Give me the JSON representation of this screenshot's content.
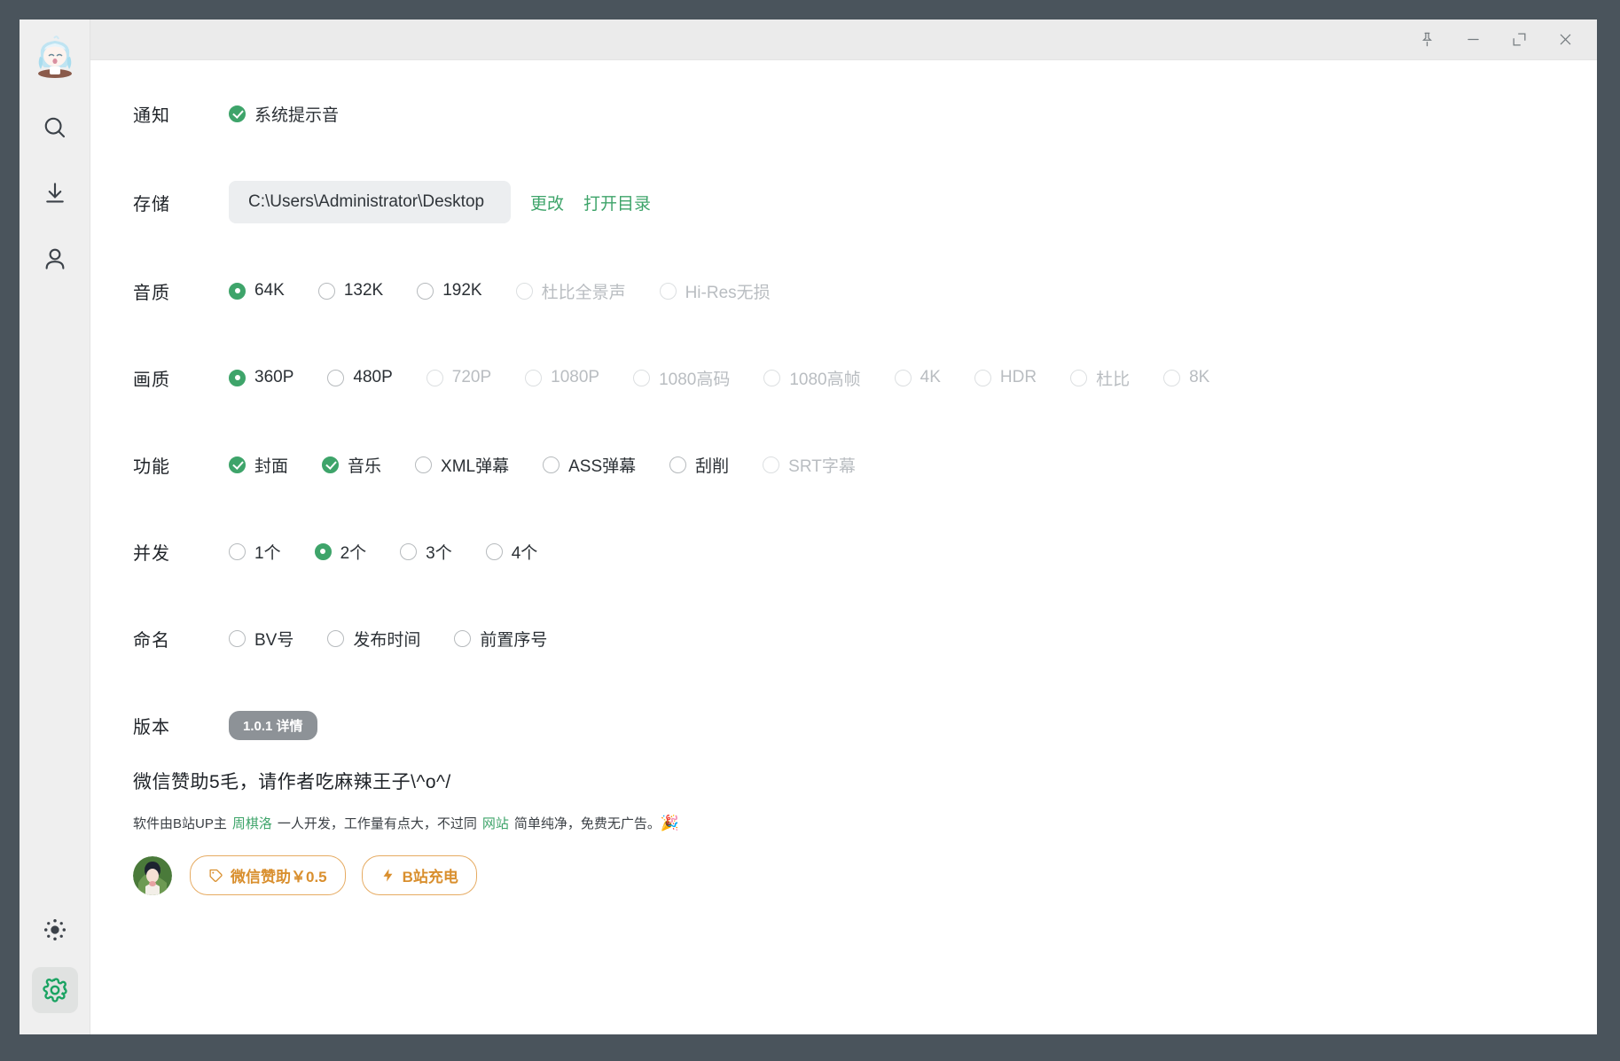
{
  "titlebar": {
    "buttons": [
      {
        "name": "pin-icon",
        "label": "置顶"
      },
      {
        "name": "minimize-icon",
        "label": "最小化"
      },
      {
        "name": "maximize-icon",
        "label": "最大化"
      },
      {
        "name": "close-icon",
        "label": "关闭"
      }
    ]
  },
  "sidebar": {
    "logo_alt": "app-avatar",
    "items": [
      {
        "name": "search",
        "label": "搜索"
      },
      {
        "name": "download",
        "label": "下载"
      },
      {
        "name": "user",
        "label": "用户"
      }
    ],
    "bottom": [
      {
        "name": "theme",
        "label": "主题"
      },
      {
        "name": "settings",
        "label": "设置",
        "active": true
      }
    ]
  },
  "settings": {
    "notification": {
      "label": "通知",
      "options": [
        {
          "text": "系统提示音",
          "checked": true,
          "disabled": false
        }
      ]
    },
    "storage": {
      "label": "存储",
      "path": "C:\\Users\\Administrator\\Desktop",
      "change_label": "更改",
      "open_label": "打开目录"
    },
    "audio_quality": {
      "label": "音质",
      "options": [
        {
          "text": "64K",
          "checked": true,
          "disabled": false
        },
        {
          "text": "132K",
          "checked": false,
          "disabled": false
        },
        {
          "text": "192K",
          "checked": false,
          "disabled": false
        },
        {
          "text": "杜比全景声",
          "checked": false,
          "disabled": true
        },
        {
          "text": "Hi-Res无损",
          "checked": false,
          "disabled": true
        }
      ]
    },
    "video_quality": {
      "label": "画质",
      "options": [
        {
          "text": "360P",
          "checked": true,
          "disabled": false
        },
        {
          "text": "480P",
          "checked": false,
          "disabled": false
        },
        {
          "text": "720P",
          "checked": false,
          "disabled": true
        },
        {
          "text": "1080P",
          "checked": false,
          "disabled": true
        },
        {
          "text": "1080高码",
          "checked": false,
          "disabled": true
        },
        {
          "text": "1080高帧",
          "checked": false,
          "disabled": true
        },
        {
          "text": "4K",
          "checked": false,
          "disabled": true
        },
        {
          "text": "HDR",
          "checked": false,
          "disabled": true
        },
        {
          "text": "杜比",
          "checked": false,
          "disabled": true
        },
        {
          "text": "8K",
          "checked": false,
          "disabled": true
        }
      ]
    },
    "features": {
      "label": "功能",
      "options": [
        {
          "text": "封面",
          "checked": true,
          "disabled": false
        },
        {
          "text": "音乐",
          "checked": true,
          "disabled": false
        },
        {
          "text": "XML弹幕",
          "checked": false,
          "disabled": false
        },
        {
          "text": "ASS弹幕",
          "checked": false,
          "disabled": false
        },
        {
          "text": "刮削",
          "checked": false,
          "disabled": false
        },
        {
          "text": "SRT字幕",
          "checked": false,
          "disabled": true
        }
      ]
    },
    "concurrency": {
      "label": "并发",
      "options": [
        {
          "text": "1个",
          "checked": false,
          "disabled": false
        },
        {
          "text": "2个",
          "checked": true,
          "disabled": false
        },
        {
          "text": "3个",
          "checked": false,
          "disabled": false
        },
        {
          "text": "4个",
          "checked": false,
          "disabled": false
        }
      ]
    },
    "naming": {
      "label": "命名",
      "options": [
        {
          "text": "BV号",
          "checked": false,
          "disabled": false
        },
        {
          "text": "发布时间",
          "checked": false,
          "disabled": false
        },
        {
          "text": "前置序号",
          "checked": false,
          "disabled": false
        }
      ]
    },
    "version": {
      "label": "版本",
      "badge": "1.0.1 详情"
    }
  },
  "sponsor": {
    "title": "微信赞助5毛，请作者吃麻辣王子\\^o^/",
    "desc_part1": "软件由B站UP主",
    "desc_link1": "周棋洛",
    "desc_part2": "一人开发，工作量有点大，不过同",
    "desc_link2": "网站",
    "desc_part3": "简单纯净，免费无广告。",
    "desc_emoji": "🎉",
    "wechat_button": "微信赞助￥0.5",
    "bilibili_button": "B站充电"
  },
  "colors": {
    "accent_green": "#3ea46a",
    "orange": "#d98f2e",
    "window_border": "#4a545c",
    "titlebar": "#ebebeb",
    "sidebar": "#efefef"
  }
}
